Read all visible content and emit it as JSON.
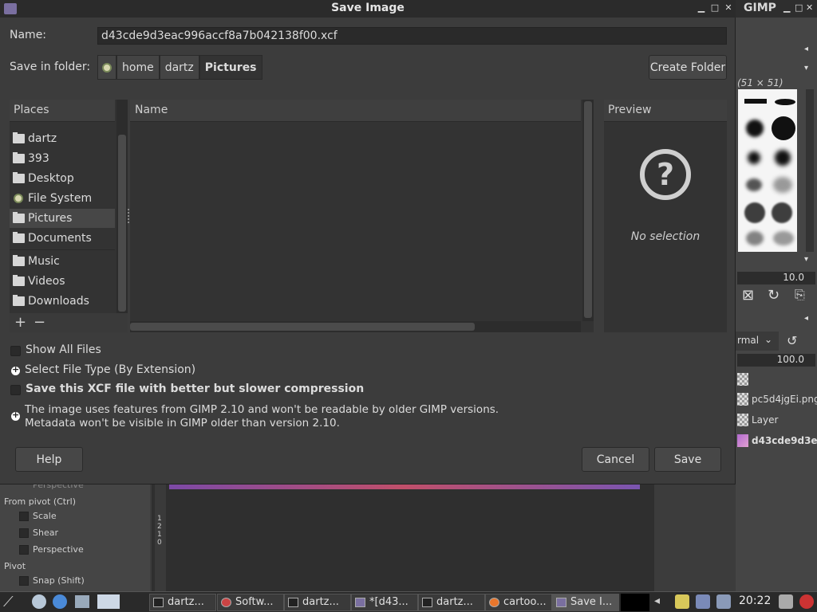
{
  "dialog": {
    "title": "Save Image",
    "name_label": "Name:",
    "filename": "d43cde9d3eac996accf8a7b042138f00.xcf",
    "folder_label": "Save in folder:",
    "breadcrumbs": [
      "home",
      "dartz",
      "Pictures"
    ],
    "create_folder": "Create Folder"
  },
  "places": {
    "header": "Places",
    "items": [
      {
        "label": "dartz",
        "icon": "folder-icon"
      },
      {
        "label": "393",
        "icon": "folder-icon"
      },
      {
        "label": "Desktop",
        "icon": "folder-icon"
      },
      {
        "label": "File System",
        "icon": "drive-icon"
      },
      {
        "label": "Pictures",
        "icon": "folder-icon",
        "selected": true
      },
      {
        "label": "Documents",
        "icon": "folder-icon"
      },
      {
        "label": "Music",
        "icon": "folder-icon"
      },
      {
        "label": "Videos",
        "icon": "folder-icon"
      },
      {
        "label": "Downloads",
        "icon": "folder-icon"
      }
    ],
    "add": "+",
    "remove": "−"
  },
  "files": {
    "header": "Name"
  },
  "preview": {
    "header": "Preview",
    "empty": "No selection",
    "icon": "help-icon"
  },
  "options": {
    "show_all_files": "Show All Files",
    "select_file_type": "Select File Type (By Extension)",
    "compression": "Save this XCF file with better but slower compression",
    "compat_line1": "The image uses features from GIMP 2.10 and won't be readable by older GIMP versions.",
    "compat_line2": "Metadata won't be visible in GIMP older than version 2.10."
  },
  "buttons": {
    "help": "Help",
    "cancel": "Cancel",
    "save": "Save"
  },
  "gimp": {
    "title": "GIMP",
    "brush_size": "(51 × 51)",
    "spacing": "10.0",
    "mode": "rmal",
    "opacity": "100.0",
    "layers": [
      "pc5d4jgEi.png",
      "Layer",
      "d43cde9d3e..."
    ]
  },
  "tool_options": {
    "perspective_top": "Perspective",
    "from_pivot": "From pivot  (Ctrl)",
    "scale": "Scale",
    "shear": "Shear",
    "perspective": "Perspective",
    "pivot": "Pivot",
    "snap": "Snap (Shift)",
    "ruler": [
      "1",
      "2",
      "1",
      "0"
    ]
  },
  "taskbar": {
    "tasks": [
      "dartz...",
      "Softw...",
      "dartz...",
      "*[d43...",
      "dartz...",
      "cartoo...",
      "Save I..."
    ],
    "clock": "20:22"
  }
}
